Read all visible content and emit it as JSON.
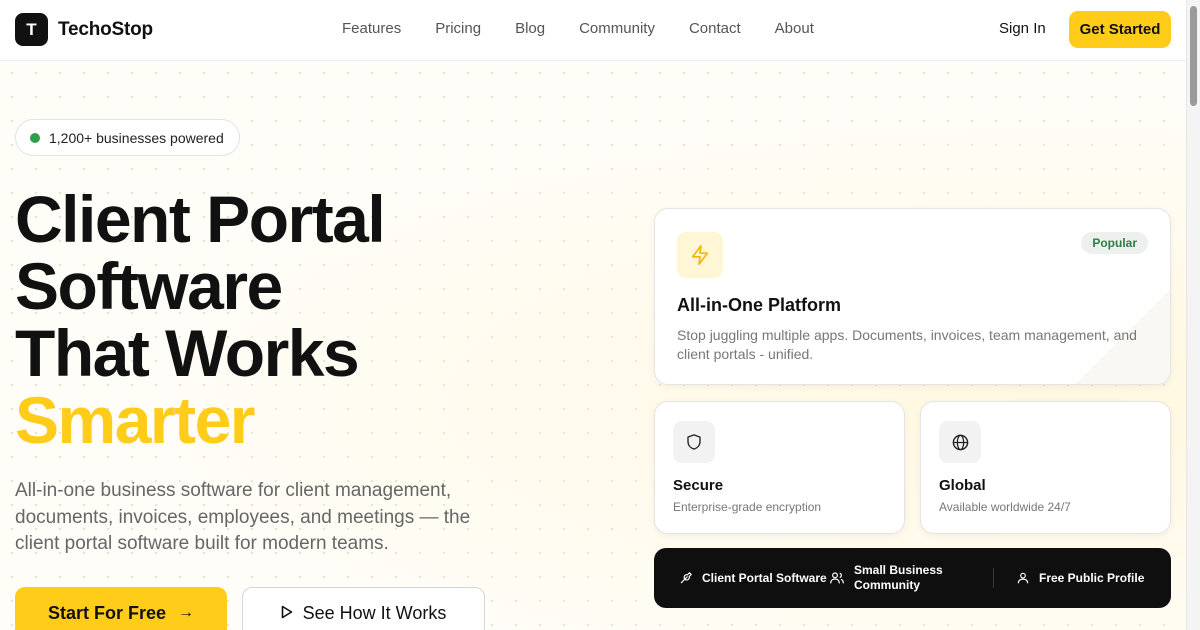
{
  "header": {
    "logo_letter": "T",
    "brand": "TechoStop",
    "nav": [
      "Features",
      "Pricing",
      "Blog",
      "Community",
      "Contact",
      "About"
    ],
    "sign_in": "Sign In",
    "get_started": "Get Started"
  },
  "hero": {
    "badge": "1,200+ businesses powered",
    "headline_lines": [
      "Client Portal",
      "Software",
      "That Works"
    ],
    "headline_accent": "Smarter",
    "subtitle": "All-in-one business software for client management, documents, invoices, employees, and meetings — the client portal software built for modern teams.",
    "cta_primary": "Start For Free",
    "cta_secondary": "See How It Works"
  },
  "cards": {
    "main": {
      "icon": "lightning-icon",
      "tag": "Popular",
      "title": "All-in-One Platform",
      "desc": "Stop juggling multiple apps. Documents, invoices, team management, and client portals - unified."
    },
    "secure": {
      "icon": "shield-icon",
      "title": "Secure",
      "desc": "Enterprise-grade encryption"
    },
    "global": {
      "icon": "globe-icon",
      "title": "Global",
      "desc": "Available worldwide 24/7"
    }
  },
  "bar": {
    "item1": "Client Portal Software",
    "item2_line1": "Small Business",
    "item2_line2": "Community",
    "item3": "Free Public Profile"
  },
  "colors": {
    "accent": "#ffcc1a",
    "dark": "#0f0f10",
    "badge_dot": "#2e9e4a"
  }
}
